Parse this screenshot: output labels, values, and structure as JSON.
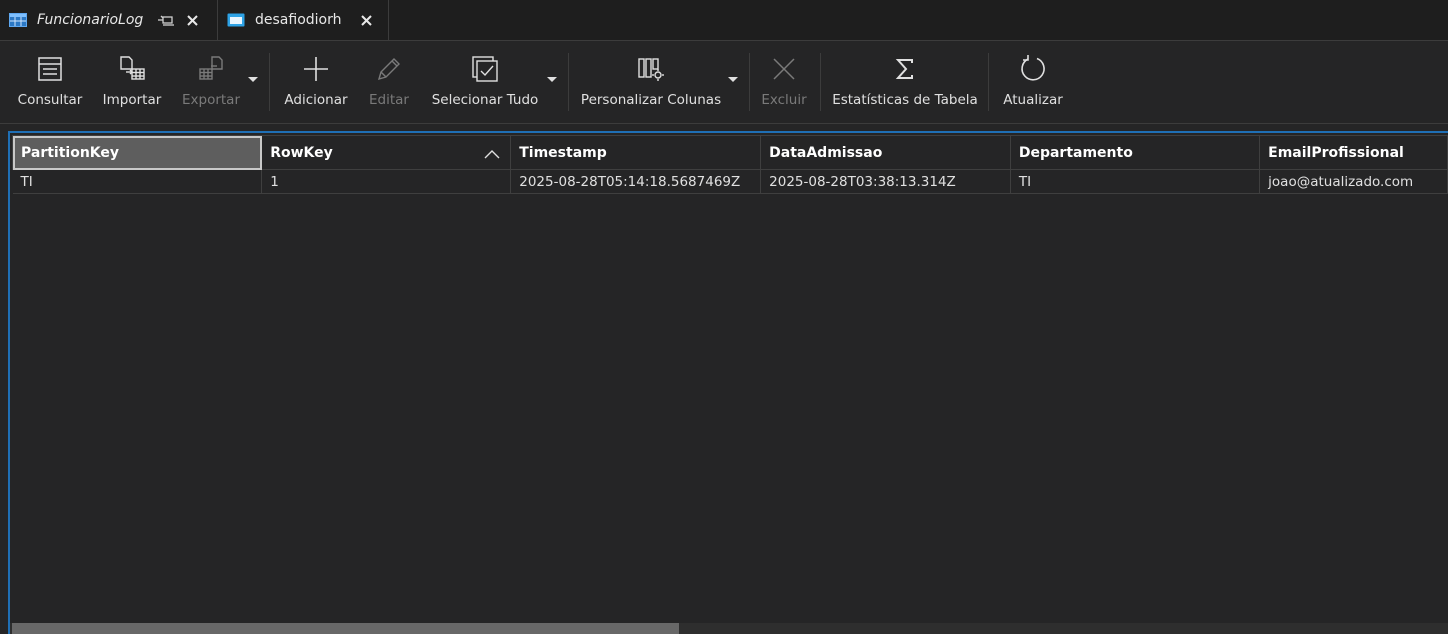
{
  "tabs": [
    {
      "label": "FuncionarioLog",
      "icon": "table-icon",
      "active": true
    },
    {
      "label": "desafiodiorh",
      "icon": "storage-account-icon",
      "active": false
    }
  ],
  "toolbar": {
    "consultar": "Consultar",
    "importar": "Importar",
    "exportar": "Exportar",
    "adicionar": "Adicionar",
    "editar": "Editar",
    "selecionar_tudo": "Selecionar Tudo",
    "personalizar_colunas": "Personalizar Colunas",
    "excluir": "Excluir",
    "estatisticas": "Estatísticas de Tabela",
    "atualizar": "Atualizar"
  },
  "table": {
    "columns": [
      "PartitionKey",
      "RowKey",
      "Timestamp",
      "DataAdmissao",
      "Departamento",
      "EmailProfissional"
    ],
    "sorted_column": "RowKey",
    "sort_direction": "ascending",
    "rows": [
      [
        "TI",
        "1",
        "2025-08-28T05:14:18.5687469Z",
        "2025-08-28T03:38:13.314Z",
        "TI",
        "joao@atualizado.com"
      ]
    ]
  },
  "colors": {
    "accent": "#1f6fb5",
    "background": "#252526",
    "header_active": "#5e5e5e"
  }
}
